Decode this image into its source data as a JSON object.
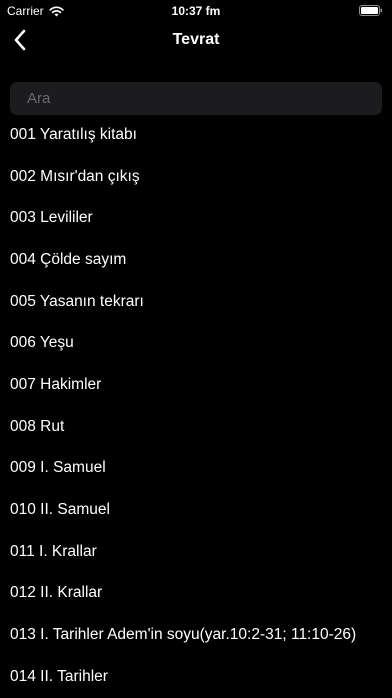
{
  "status_bar": {
    "carrier": "Carrier",
    "time": "10:37 fm"
  },
  "nav": {
    "title": "Tevrat",
    "back_icon": "chevron-left-icon"
  },
  "search": {
    "placeholder": "Ara",
    "value": ""
  },
  "books": [
    {
      "label": "001 Yaratılış kitabı"
    },
    {
      "label": "002 Mısır'dan çıkış"
    },
    {
      "label": "003 Levililer"
    },
    {
      "label": "004 Çölde sayım"
    },
    {
      "label": "005 Yasanın tekrarı"
    },
    {
      "label": "006 Yeşu"
    },
    {
      "label": "007 Hakimler"
    },
    {
      "label": "008 Rut"
    },
    {
      "label": "009 I. Samuel"
    },
    {
      "label": "010 II. Samuel"
    },
    {
      "label": "011 I. Krallar"
    },
    {
      "label": "012 II. Krallar"
    },
    {
      "label": "013 I. Tarihler Adem'in soyu(yar.10:2-31; 11:10-26)"
    },
    {
      "label": "014 II. Tarihler"
    }
  ],
  "colors": {
    "background": "#000000",
    "text": "#ffffff",
    "search_background": "#1c1c1e",
    "placeholder": "#6b6b70"
  }
}
